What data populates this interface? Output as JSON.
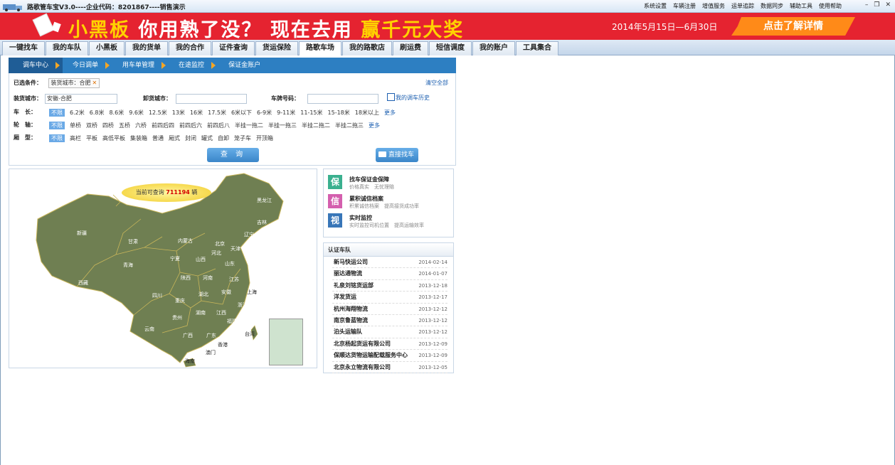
{
  "app": {
    "title": "路歌管车宝V3.0----企业代码：8201867----销售演示",
    "top_menu": [
      "系统设置",
      "车辆注册",
      "增值服务",
      "运单追踪",
      "数据同步",
      "辅助工具",
      "使用帮助"
    ]
  },
  "banner": {
    "slogan_part1": "小黑板",
    "slogan_part2": "你用熟了没？",
    "slogan_part3": "现在去用",
    "slogan_part4": "赢千元大奖",
    "date_range": "2014年5月15日—6月30日",
    "cta": "点击了解详情"
  },
  "nav": {
    "tabs": [
      "一键找车",
      "我的车队",
      "小黑板",
      "我的货单",
      "我的合作",
      "证件查询",
      "货运保险",
      "路歌车场",
      "我的路歌店",
      "刷运费",
      "短信调度",
      "我的账户",
      "工具集合"
    ],
    "active": "路歌车场"
  },
  "subnav": [
    "调车中心",
    "今日调单",
    "用车单管理",
    "在途监控",
    "保证金账户"
  ],
  "filter": {
    "selected_label": "已选条件：",
    "selected_tag": "装货城市：合肥",
    "clear_all": "清空全部",
    "load_city_label": "装货城市：",
    "load_city_value": "安徽-合肥",
    "unload_city_label": "卸货城市：",
    "plate_label": "车牌号码：",
    "history_link": "我的调车历史",
    "length_label": "车　长：",
    "length_options": [
      "不限",
      "6.2米",
      "6.8米",
      "8.6米",
      "9.6米",
      "12.5米",
      "13米",
      "16米",
      "17.5米",
      "6米以下",
      "6-9米",
      "9-11米",
      "11-15米",
      "15-18米",
      "18米以上"
    ],
    "axle_label": "轮　轴：",
    "axle_options": [
      "不限",
      "单桥",
      "双桥",
      "四桥",
      "五桥",
      "六桥",
      "前四后四",
      "前四后六",
      "前四后八",
      "半挂一拖二",
      "半挂一拖三",
      "半挂二拖二",
      "半挂二拖三"
    ],
    "body_label": "厢　型：",
    "body_options": [
      "不限",
      "高栏",
      "平板",
      "高低平板",
      "集装箱",
      "普通",
      "厢式",
      "封闭",
      "罐式",
      "自卸",
      "笼子车",
      "开顶箱"
    ],
    "more": "更多",
    "query_button": "查 询",
    "direct_button": "直接找车"
  },
  "map": {
    "bubble_prefix": "当前可查询",
    "bubble_count": "711194",
    "bubble_suffix": "辆",
    "provinces": [
      "黑龙江",
      "吉林",
      "辽宁",
      "新疆",
      "甘肃",
      "内蒙古",
      "北京",
      "天津",
      "河北",
      "宁夏",
      "山西",
      "山东",
      "青海",
      "陕西",
      "河南",
      "西藏",
      "江苏",
      "四川",
      "湖北",
      "安徽",
      "上海",
      "重庆",
      "浙江",
      "湖南",
      "江西",
      "贵州",
      "福建",
      "云南",
      "广西",
      "广东",
      "台湾",
      "香港",
      "澳门",
      "海南"
    ]
  },
  "features": [
    {
      "icon": "保",
      "title": "找车保证金保障",
      "sub": "价格真实　无忧理赔",
      "color": "#3bb08f"
    },
    {
      "icon": "信",
      "title": "累积诚信档案",
      "sub": "积累诚信档案　提高接货成功率",
      "color": "#d45fae"
    },
    {
      "icon": "视",
      "title": "实时监控",
      "sub": "实时监控司机位置　提高运输效率",
      "color": "#3876b8"
    }
  ],
  "certified": {
    "header": "认证车队",
    "items": [
      {
        "name": "新马快运公司",
        "date": "2014-02-14"
      },
      {
        "name": "丽达通物流",
        "date": "2014-01-07"
      },
      {
        "name": "礼泉刘铭货运部",
        "date": "2013-12-18"
      },
      {
        "name": "洋发货运",
        "date": "2013-12-17"
      },
      {
        "name": "杭州海翔物流",
        "date": "2013-12-12"
      },
      {
        "name": "南京鲁蓝物流",
        "date": "2013-12-12"
      },
      {
        "name": "泊头运输队",
        "date": "2013-12-12"
      },
      {
        "name": "北京杨起货运有限公司",
        "date": "2013-12-09"
      },
      {
        "name": "保顺达货物运输配载服务中心",
        "date": "2013-12-09"
      },
      {
        "name": "北京永立物流有限公司",
        "date": "2013-12-05"
      }
    ]
  }
}
